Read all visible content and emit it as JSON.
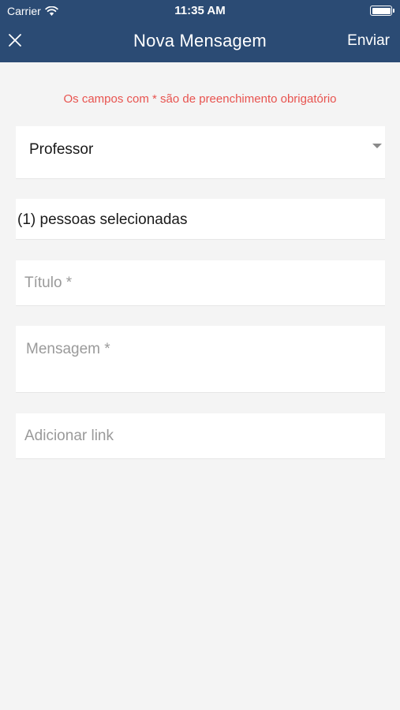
{
  "status_bar": {
    "carrier": "Carrier",
    "time": "11:35 AM",
    "battery_level": 1.0
  },
  "nav": {
    "title": "Nova Mensagem",
    "close_icon": "close-icon",
    "send_label": "Enviar"
  },
  "form": {
    "required_note": "Os campos com * são de preenchimento obrigatório",
    "recipient_type": {
      "selected": "Professor",
      "icon": "dropdown-caret-icon"
    },
    "recipients_summary": "(1) pessoas selecionadas",
    "title_placeholder": "Título *",
    "message_placeholder": "Mensagem *",
    "link_placeholder": "Adicionar link"
  },
  "colors": {
    "header_bg": "#2b4b74",
    "background": "#f4f4f4",
    "required_note": "#e8534f"
  }
}
